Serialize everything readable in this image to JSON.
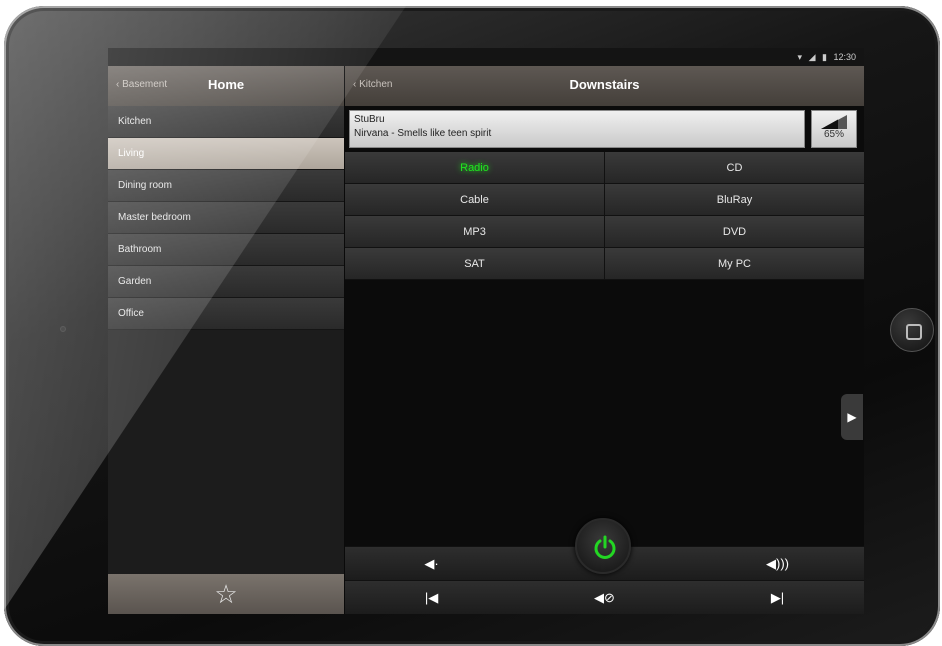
{
  "status": {
    "wifi": "wifi-icon",
    "signal": "signal-icon",
    "battery": "battery-icon",
    "time": "12:30"
  },
  "left": {
    "back_label": "Basement",
    "title": "Home",
    "rooms": [
      {
        "label": "Kitchen",
        "active": false
      },
      {
        "label": "Living",
        "active": true
      },
      {
        "label": "Dining room",
        "active": false
      },
      {
        "label": "Master bedroom",
        "active": false
      },
      {
        "label": "Bathroom",
        "active": false
      },
      {
        "label": "Garden",
        "active": false
      },
      {
        "label": "Office",
        "active": false
      }
    ],
    "favorites_icon": "star-icon"
  },
  "right": {
    "back_label": "Kitchen",
    "title": "Downstairs",
    "now_playing": {
      "station": "StuBru",
      "track": "Nirvana - Smells like teen spirit"
    },
    "volume": {
      "percent": 65,
      "label": "65%"
    },
    "sources": [
      [
        "Radio",
        "CD"
      ],
      [
        "Cable",
        "BluRay"
      ],
      [
        "MP3",
        "DVD"
      ],
      [
        "SAT",
        "My PC"
      ]
    ],
    "active_source": "Radio",
    "controls": {
      "row1": [
        "volume-down-icon",
        "power-icon",
        "volume-up-icon"
      ],
      "row2": [
        "skip-previous-icon",
        "mute-icon",
        "skip-next-icon"
      ]
    }
  },
  "colors": {
    "active_source": "#1fe81f",
    "power": "#23d623",
    "selected_room": "#bdb4aa"
  }
}
